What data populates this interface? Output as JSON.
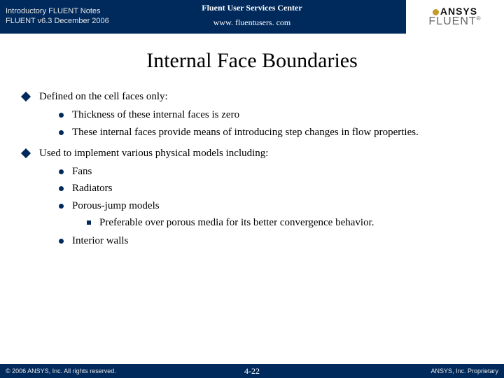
{
  "header": {
    "line1": "Introductory FLUENT Notes",
    "line2": "FLUENT v6.3  December 2006",
    "service_center": "Fluent User Services Center",
    "url": "www. fluentusers. com",
    "brand_top": "ANSYS",
    "brand_bottom": "FLUENT",
    "reg": "®"
  },
  "title": "Internal Face Boundaries",
  "bullets": {
    "b1": "Defined on the cell faces only:",
    "b1_1": "Thickness of these internal faces is zero",
    "b1_2": "These internal faces provide means of introducing step changes in flow properties.",
    "b2": "Used to implement various physical models including:",
    "b2_1": "Fans",
    "b2_2": "Radiators",
    "b2_3": "Porous-jump models",
    "b2_3_1": "Preferable over porous media for its better convergence behavior.",
    "b2_4": "Interior walls"
  },
  "footer": {
    "left": "© 2006 ANSYS, Inc. All rights reserved.",
    "center": "4-22",
    "right": "ANSYS, Inc. Proprietary"
  }
}
